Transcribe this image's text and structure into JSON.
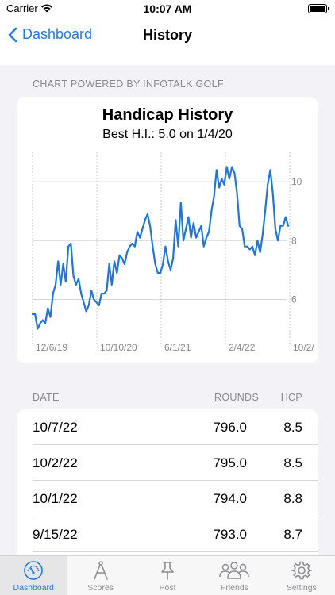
{
  "status": {
    "carrier": "Carrier",
    "time": "10:07 AM"
  },
  "nav": {
    "back_label": "Dashboard",
    "title": "History"
  },
  "chart_caption": "CHART POWERED BY INFOTALK GOLF",
  "chart_data": {
    "type": "line",
    "title": "Handicap History",
    "subtitle": "Best H.I.: 5.0 on 1/4/20",
    "xlabel": "",
    "ylabel": "",
    "x_tick_labels": [
      "12/6/19",
      "10/10/20",
      "6/1/21",
      "2/4/22",
      "10/2/"
    ],
    "y_ticks": [
      6,
      8,
      10
    ],
    "ylim": [
      4.8,
      11.0
    ],
    "grid": true,
    "y_axis_side": "right",
    "color": "#1f74e0",
    "series": [
      {
        "values": [
          5.5,
          5.5,
          5.0,
          5.2,
          5.3,
          5.2,
          5.7,
          5.4,
          6.2,
          6.5,
          7.3,
          6.5,
          7.2,
          6.6,
          7.8,
          7.9,
          6.8,
          6.5,
          6.7,
          6.2,
          5.9,
          5.6,
          5.8,
          6.3,
          6.0,
          5.9,
          5.8,
          6.2,
          6.2,
          6.3,
          7.2,
          6.5,
          7.3,
          6.9,
          7.5,
          7.4,
          7.2,
          7.6,
          7.8,
          7.9,
          7.8,
          8.3,
          8.1,
          8.4,
          8.7,
          8.9,
          8.5,
          7.8,
          7.2,
          6.9,
          6.9,
          7.2,
          7.8,
          7.3,
          7.0,
          7.4,
          8.7,
          7.8,
          9.3,
          8.0,
          8.4,
          8.8,
          8.1,
          8.6,
          8.1,
          8.3,
          8.5,
          7.8,
          8.1,
          8.3,
          9.0,
          9.5,
          10.4,
          9.8,
          10.1,
          9.9,
          10.5,
          10.1,
          10.5,
          10.3,
          9.6,
          8.5,
          8.4,
          7.8,
          7.8,
          7.7,
          7.8,
          7.5,
          8.0,
          7.6,
          8.2,
          9.0,
          9.9,
          10.4,
          9.6,
          8.4,
          8.0,
          8.5,
          8.5,
          8.8,
          8.5
        ]
      }
    ]
  },
  "table": {
    "headers": {
      "date": "DATE",
      "rounds": "ROUNDS",
      "hcp": "HCP"
    },
    "rows": [
      {
        "date": "10/7/22",
        "rounds": "796.0",
        "hcp": "8.5"
      },
      {
        "date": "10/2/22",
        "rounds": "795.0",
        "hcp": "8.5"
      },
      {
        "date": "10/1/22",
        "rounds": "794.0",
        "hcp": "8.8"
      },
      {
        "date": "9/15/22",
        "rounds": "793.0",
        "hcp": "8.7"
      },
      {
        "date": "",
        "rounds": "",
        "hcp": ""
      }
    ]
  },
  "tabs": [
    {
      "label": "Dashboard",
      "icon": "gauge-icon",
      "active": true
    },
    {
      "label": "Scores",
      "icon": "compass-icon",
      "active": false
    },
    {
      "label": "Post",
      "icon": "pin-icon",
      "active": false
    },
    {
      "label": "Friends",
      "icon": "people-icon",
      "active": false
    },
    {
      "label": "Settings",
      "icon": "gear-icon",
      "active": false
    }
  ]
}
